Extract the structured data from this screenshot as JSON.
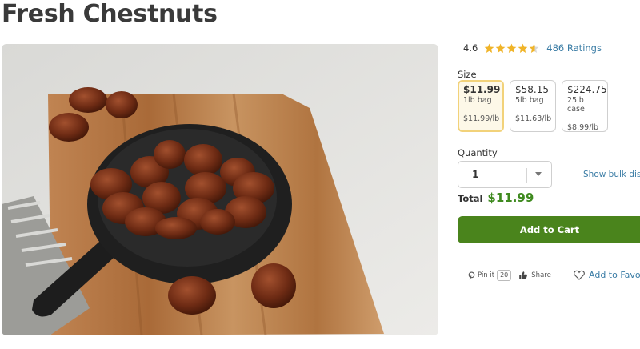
{
  "product": {
    "title": "Fresh Chestnuts",
    "image_alt": "chestnuts-in-cast-iron-skillet-photo"
  },
  "rating": {
    "score": "4.6",
    "stars": 4.6,
    "ratings_count_label": "486 Ratings"
  },
  "size": {
    "label": "Size",
    "options": [
      {
        "price": "$11.99",
        "unit": "1lb bag",
        "per_lb": "$11.99/lb",
        "selected": true
      },
      {
        "price": "$58.15",
        "unit": "5lb bag",
        "per_lb": "$11.63/lb",
        "selected": false
      },
      {
        "price": "$224.75",
        "unit": "25lb case",
        "per_lb": "$8.99/lb",
        "selected": false
      }
    ]
  },
  "quantity": {
    "label": "Quantity",
    "value": "1",
    "bulk_link": "Show bulk disco"
  },
  "total": {
    "label": "Total",
    "value": "$11.99"
  },
  "cart": {
    "add_label": "Add to Cart"
  },
  "social": {
    "pin_label": "Pin it",
    "pin_count": "20",
    "share_label": "Share",
    "favorite_label": "Add to Favor"
  },
  "colors": {
    "accent_green": "#4a841c",
    "total_green": "#3f8a1f",
    "link_blue": "#3a7ca5",
    "star_gold": "#f0b429",
    "selected_border": "#f2d27a"
  }
}
